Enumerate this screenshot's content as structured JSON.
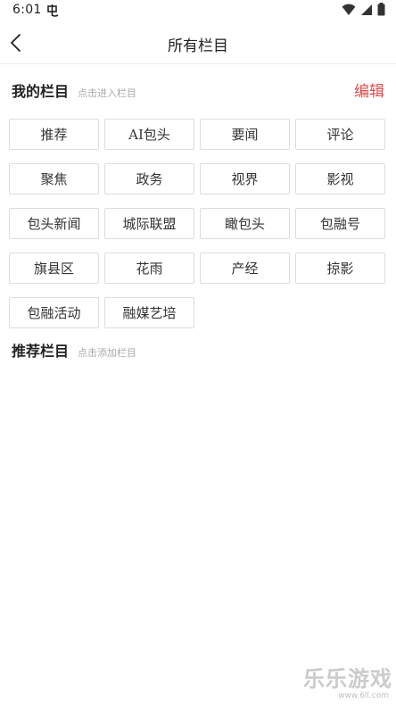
{
  "status_bar": {
    "time": "6:01",
    "app_icon": "app-notification-icon",
    "icons": [
      "wifi-icon",
      "signal-icon",
      "battery-icon"
    ]
  },
  "header": {
    "title": "所有栏目",
    "back_icon": "chevron-left-icon"
  },
  "my_channels": {
    "title": "我的栏目",
    "hint": "点击进入栏目",
    "edit_label": "编辑",
    "items": [
      "推荐",
      "AI包头",
      "要闻",
      "评论",
      "聚焦",
      "政务",
      "视界",
      "影视",
      "包头新闻",
      "城际联盟",
      "瞰包头",
      "包融号",
      "旗县区",
      "花雨",
      "产经",
      "掠影",
      "包融活动",
      "融媒艺培"
    ]
  },
  "recommended_channels": {
    "title": "推荐栏目",
    "hint": "点击添加栏目"
  },
  "watermark": {
    "text": "乐乐游戏",
    "url": "www.6ll.com"
  },
  "colors": {
    "accent": "#e04a4a",
    "border": "#dddddd",
    "hint": "#aaaaaa"
  }
}
